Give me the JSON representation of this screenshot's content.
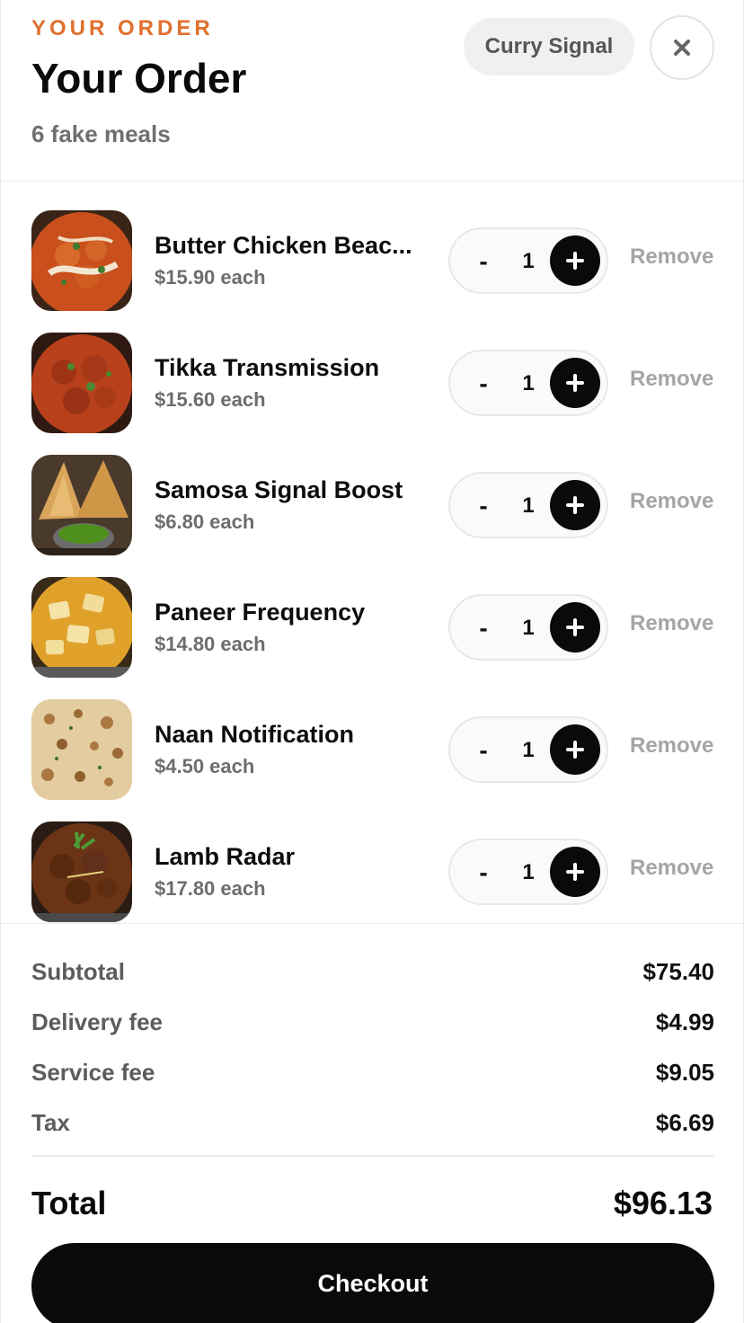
{
  "header": {
    "eyebrow": "YOUR ORDER",
    "title": "Your Order",
    "subtitle": "6 fake meals",
    "restaurant": "Curry Signal",
    "close_icon": "close-icon"
  },
  "items": [
    {
      "name": "Butter Chicken Beac...",
      "price": "$15.90 each",
      "qty": "1",
      "minus": "-",
      "remove": "Remove",
      "image": "butter-chicken-photo"
    },
    {
      "name": "Tikka Transmission",
      "price": "$15.60 each",
      "qty": "1",
      "minus": "-",
      "remove": "Remove",
      "image": "tikka-photo"
    },
    {
      "name": "Samosa Signal Boost",
      "price": "$6.80 each",
      "qty": "1",
      "minus": "-",
      "remove": "Remove",
      "image": "samosa-photo"
    },
    {
      "name": "Paneer Frequency",
      "price": "$14.80 each",
      "qty": "1",
      "minus": "-",
      "remove": "Remove",
      "image": "paneer-photo"
    },
    {
      "name": "Naan Notification",
      "price": "$4.50 each",
      "qty": "1",
      "minus": "-",
      "remove": "Remove",
      "image": "naan-photo"
    },
    {
      "name": "Lamb Radar",
      "price": "$17.80 each",
      "qty": "1",
      "minus": "-",
      "remove": "Remove",
      "image": "lamb-curry-photo"
    }
  ],
  "summary": {
    "subtotal_label": "Subtotal",
    "subtotal": "$75.40",
    "delivery_label": "Delivery fee",
    "delivery": "$4.99",
    "service_label": "Service fee",
    "service": "$9.05",
    "tax_label": "Tax",
    "tax": "$6.69",
    "total_label": "Total",
    "total": "$96.13"
  },
  "checkout_label": "Checkout",
  "colors": {
    "accent": "#e0702e",
    "primary": "#0a0a0a",
    "muted": "#6d6d6d",
    "remove": "#a5a5a5"
  }
}
